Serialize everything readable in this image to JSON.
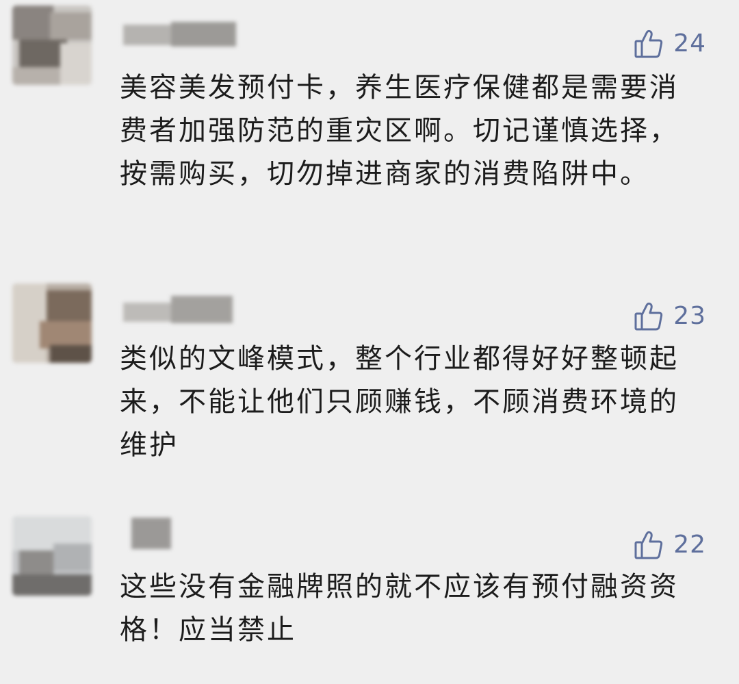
{
  "comments": [
    {
      "likes": "24",
      "text": "美容美发预付卡，养生医疗保健都是需要消费者加强防范的重灾区啊。切记谨慎选择，按需购买，切勿掉进商家的消费陷阱中。"
    },
    {
      "likes": "23",
      "text": "类似的文峰模式，整个行业都得好好整顿起来，不能让他们只顾赚钱，不顾消费环境的维护"
    },
    {
      "likes": "22",
      "text": "这些没有金融牌照的就不应该有预付融资资格！应当禁止"
    }
  ],
  "icons": {
    "like": "thumbs-up-icon"
  },
  "colors": {
    "background": "#efefef",
    "like_accent": "#5e6f9c",
    "text": "#1c1c1c"
  }
}
